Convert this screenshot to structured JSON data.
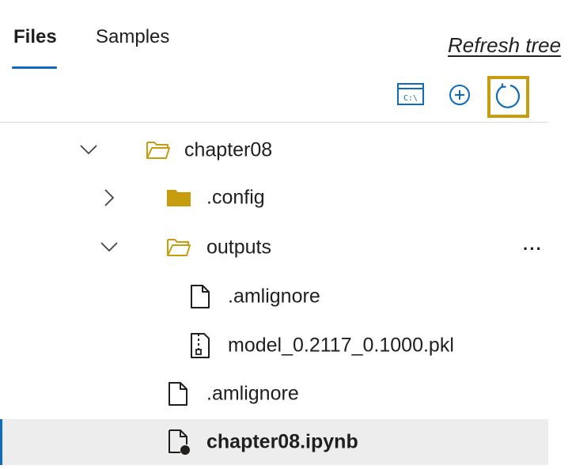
{
  "tabs": [
    {
      "label": "Files",
      "active": true
    },
    {
      "label": "Samples",
      "active": false
    }
  ],
  "annotation": "Refresh tree",
  "toolbar": {
    "terminal_icon": "terminal-icon",
    "terminal_text": "C:\\",
    "add_icon": "add-icon",
    "refresh_icon": "refresh-icon"
  },
  "tree": {
    "chapter08": {
      "name": "chapter08",
      "expanded": true,
      "icon": "folder-open-icon"
    },
    "config": {
      "name": ".config",
      "expanded": false,
      "icon": "folder-icon"
    },
    "outputs": {
      "name": "outputs",
      "expanded": true,
      "icon": "folder-open-icon",
      "more": "···"
    },
    "outputs_amlignore": {
      "name": ".amlignore",
      "icon": "file-icon"
    },
    "model_pkl": {
      "name": "model_0.2117_0.1000.pkl",
      "icon": "zip-file-icon"
    },
    "amlignore": {
      "name": ".amlignore",
      "icon": "file-icon"
    },
    "notebook": {
      "name": "chapter08.ipynb",
      "icon": "notebook-file-icon",
      "selected": true
    }
  },
  "colors": {
    "accent": "#0f6cbd",
    "folder": "#c79c0f",
    "highlight": "#c79c0f",
    "selected_bg": "#ededed"
  }
}
